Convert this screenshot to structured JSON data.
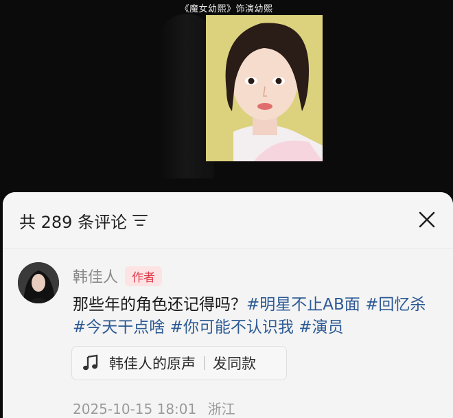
{
  "video": {
    "caption": "《魔女幼熙》饰演幼熙"
  },
  "comments_panel": {
    "title": "共 289 条评论",
    "filter_icon": "filter-icon",
    "close_icon": "close-icon"
  },
  "comment": {
    "author": "韩佳人",
    "badge": "作者",
    "text_plain": "那些年的角色还记得吗？",
    "tags": [
      "#明星不止AB面",
      "#回忆杀",
      "#今天干点啥",
      "#你可能不认识我",
      "#演员"
    ],
    "sound": {
      "icon": "music-note-icon",
      "title": "韩佳人的原声",
      "action": "发同款"
    },
    "timestamp": "2025-10-15 18:01",
    "location": "浙江"
  },
  "colors": {
    "tag": "#2d5a94",
    "badge_bg": "#fde3e3",
    "badge_text": "#e0394a",
    "sheet_bg": "#f2f2f2"
  }
}
